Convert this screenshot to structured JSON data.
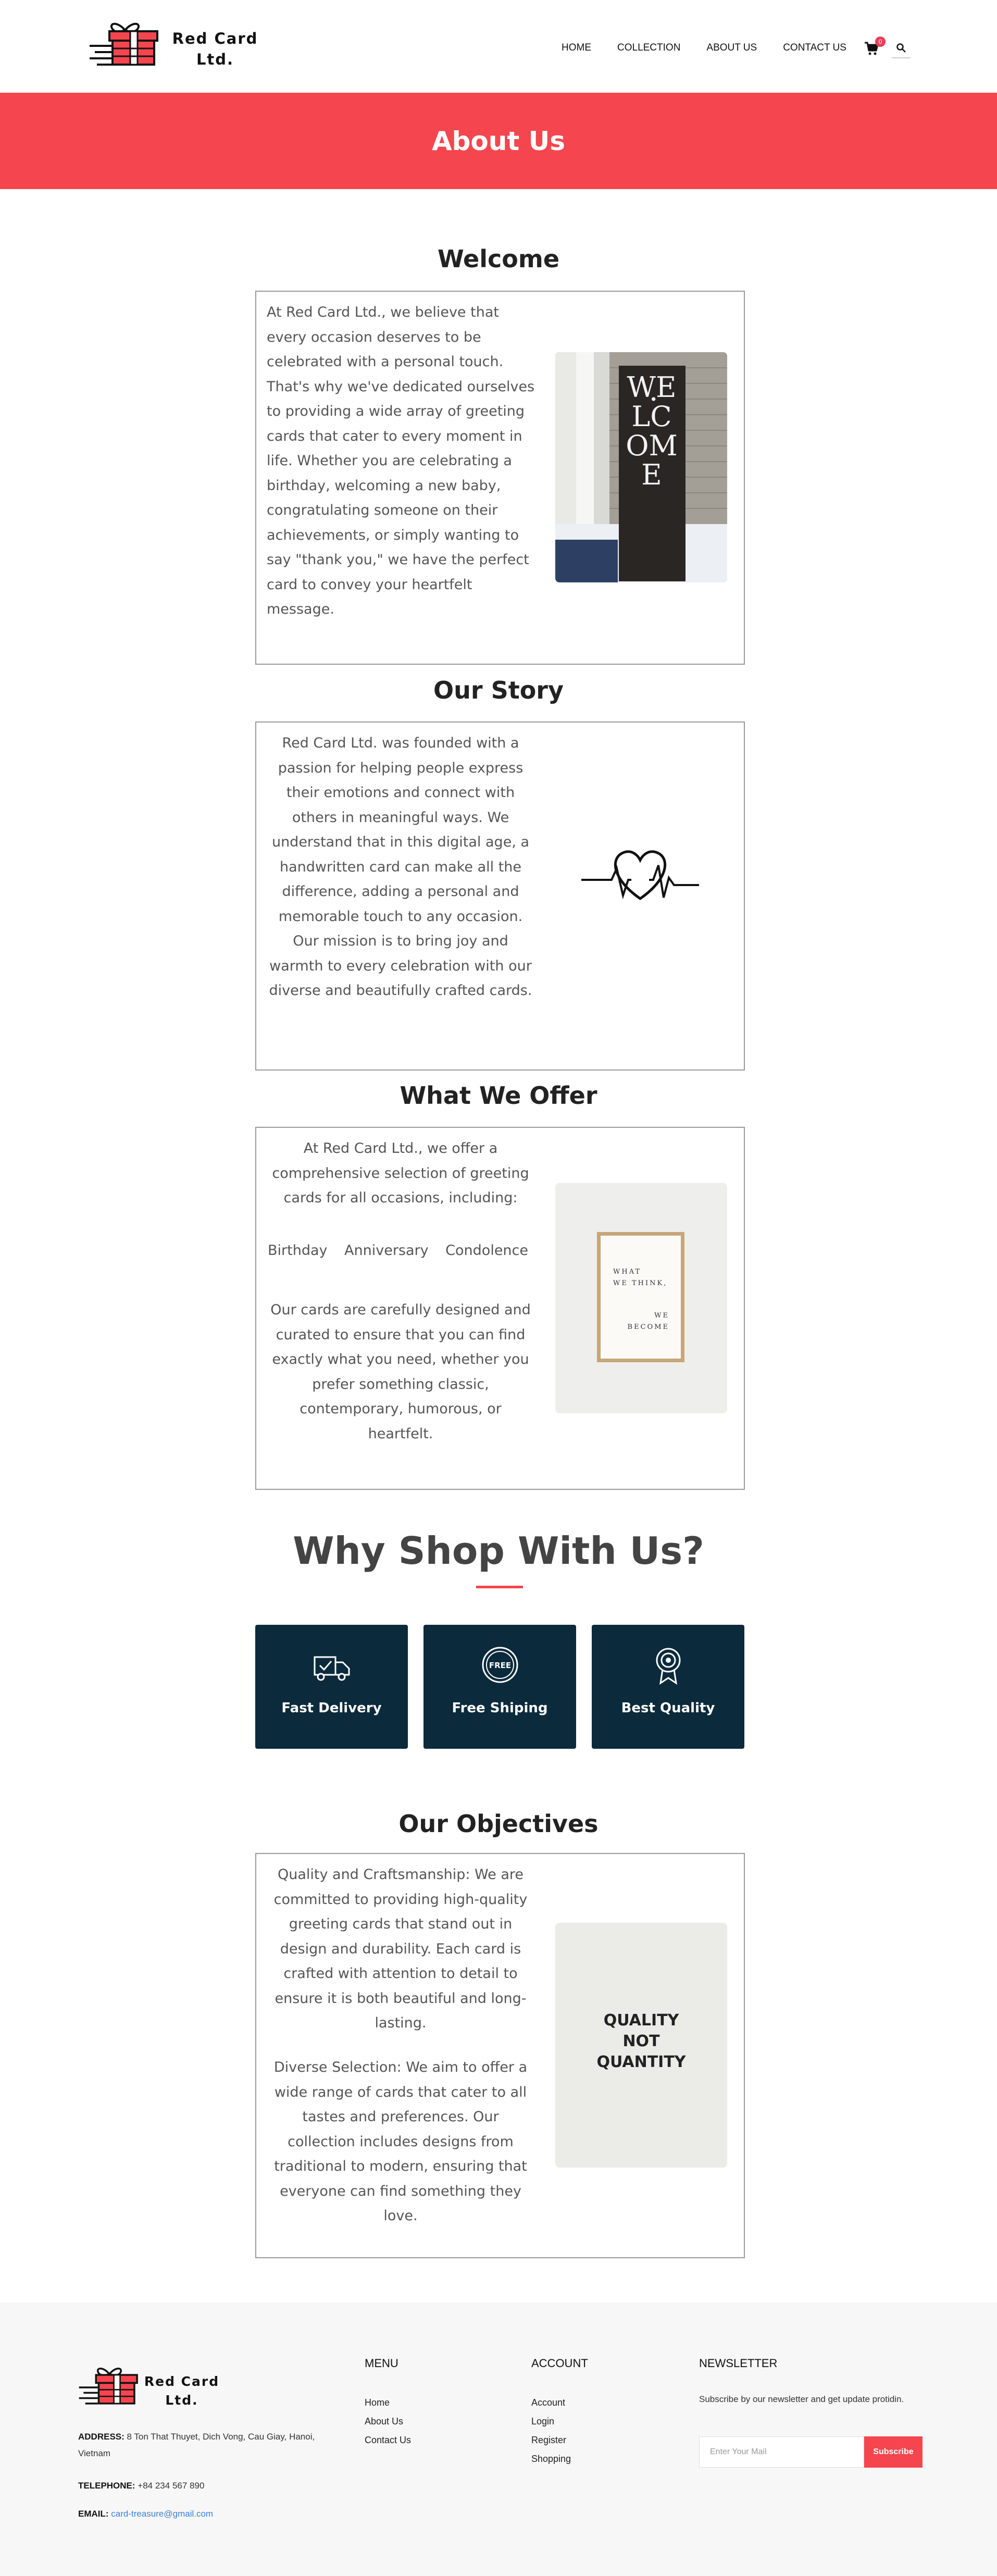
{
  "header": {
    "logo_line1": "Red Card",
    "logo_line2": "Ltd.",
    "nav": [
      "HOME",
      "COLLECTION",
      "ABOUT US",
      "CONTACT US"
    ],
    "cart_count": "0",
    "icons": {
      "cart": "cart-icon",
      "search": "search-icon"
    }
  },
  "banner": {
    "title": "About Us"
  },
  "welcome": {
    "title": "Welcome",
    "text": "At Red Card Ltd., we believe that every occasion deserves to be celebrated with a personal touch. That's why we've dedicated ourselves to providing a wide array of greeting cards that cater to every moment in life. Whether you are celebrating a birthday, welcoming a new baby, congratulating someone on their achievements, or simply wanting to say \"thank you,\" we have the perfect card to convey your heartfelt message.",
    "image_sign_text": "WELCOME"
  },
  "story": {
    "title": "Our Story",
    "text": "Red Card Ltd. was founded with a passion for helping people express their emotions and connect with others in meaningful ways. We understand that in this digital age, a handwritten card can make all the difference, adding a personal and memorable touch to any occasion. Our mission is to bring joy and warmth to every celebration with our diverse and beautifully crafted cards."
  },
  "offer": {
    "title": "What We Offer",
    "intro": "At Red Card Ltd., we offer a comprehensive selection of greeting cards for all occasions, including:",
    "items": [
      "Birthday",
      "Anniversary",
      "Condolence"
    ],
    "outro": "Our cards are carefully designed and curated to ensure that you can find exactly what you need, whether you prefer something classic, contemporary, humorous, or heartfelt.",
    "frame_line1": "WHAT",
    "frame_line2": "WE THINK,",
    "frame_line3": "WE",
    "frame_line4": "BECOME"
  },
  "why": {
    "title": "Why Shop With Us?",
    "features": [
      {
        "label": "Fast Delivery",
        "icon": "delivery-truck-icon"
      },
      {
        "label": "Free Shiping",
        "icon": "free-badge-icon",
        "badge_text": "FREE"
      },
      {
        "label": "Best Quality",
        "icon": "quality-award-icon"
      }
    ]
  },
  "objectives": {
    "title": "Our Objectives",
    "p1": "Quality and Craftsmanship: We are committed to providing high-quality greeting cards that stand out in design and durability. Each card is crafted with attention to detail to ensure it is both beautiful and long-lasting.",
    "p2": "Diverse Selection: We aim to offer a wide range of cards that cater to all tastes and preferences. Our collection includes designs from traditional to modern, ensuring that everyone can find something they love.",
    "image_line1": "QUALITY",
    "image_line2": "NOT",
    "image_line3": "QUANTITY"
  },
  "footer": {
    "logo_line1": "Red Card",
    "logo_line2": "Ltd.",
    "address_label": "ADDRESS:",
    "address": "8 Ton That Thuyet, Dich Vong, Cau Giay, Hanoi, Vietnam",
    "telephone_label": "TELEPHONE:",
    "telephone": "+84 234 567 890",
    "email_label": "EMAIL:",
    "email": "card-treasure@gmail.com",
    "menu_title": "MENU",
    "menu": [
      "Home",
      "About Us",
      "Contact Us"
    ],
    "account_title": "ACCOUNT",
    "account": [
      "Account",
      "Login",
      "Register",
      "Shopping"
    ],
    "newsletter_title": "NEWSLETTER",
    "newsletter_text": "Subscribe by our newsletter and get update protidin.",
    "input_placeholder": "Enter Your Mail",
    "subscribe_label": "Subscribe"
  },
  "colors": {
    "accent": "#f5454f",
    "feature_bg": "#0b2b3c",
    "footer_bg": "#f7f7f7",
    "email_link": "#3b82d6"
  }
}
